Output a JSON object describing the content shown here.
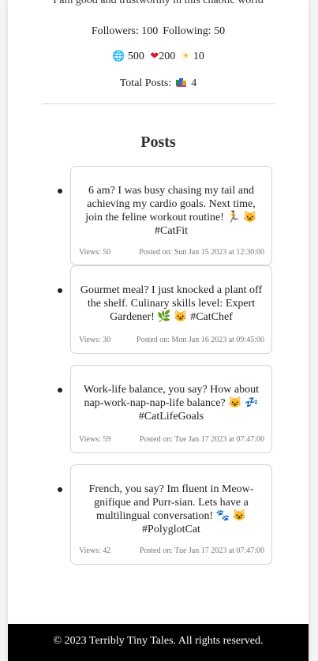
{
  "profile": {
    "bio": "I am good and trustworthy in this chaotic world",
    "followers_text": "Followers: 100",
    "following_text": "Following: 50",
    "stats": [
      {
        "icon": "globe-icon",
        "glyph": "🌐",
        "value": "500"
      },
      {
        "icon": "heart-icon",
        "glyph": "❤",
        "value": "200"
      },
      {
        "icon": "sun-icon",
        "glyph": "☀",
        "value": "10"
      }
    ],
    "total_posts_label": "Total Posts:",
    "total_posts_icon": "books-icon",
    "total_posts_value": "4"
  },
  "posts_section": {
    "title": "Posts"
  },
  "posts": [
    {
      "text": "6 am? I was busy chasing my tail and achieving my cardio goals. Next time, join the feline workout routine! 🏃 😺 #CatFit",
      "views": "Views: 50",
      "posted": "Posted on: Sun Jan 15 2023 at 12:30:00"
    },
    {
      "text": "Gourmet meal? I just knocked a plant off the shelf. Culinary skills level: Expert Gardener! 🌿 😺 #CatChef",
      "views": "Views: 30",
      "posted": "Posted on: Mon Jan 16 2023 at 09:45:00"
    },
    {
      "text": "Work-life balance, you say? How about nap-work-nap-nap-life balance? 😺 💤 #CatLifeGoals",
      "views": "Views: 59",
      "posted": "Posted on: Tue Jan 17 2023 at 07:47:00"
    },
    {
      "text": "French, you say? Im fluent in Meow-gnifique and Purr-sian. Lets have a multilingual conversation! 🐾 😺 #PolyglotCat",
      "views": "Views: 42",
      "posted": "Posted on: Tue Jan 17 2023 at 07:47:00"
    }
  ],
  "footer": {
    "text": "© 2023 Terribly Tiny Tales. All rights reserved."
  },
  "colors": {
    "footer_bg": "#000000",
    "card_border": "#d3d3d3",
    "heart": "#d81d2a",
    "globe": "#3b7fd6",
    "sun": "#f3b714"
  }
}
